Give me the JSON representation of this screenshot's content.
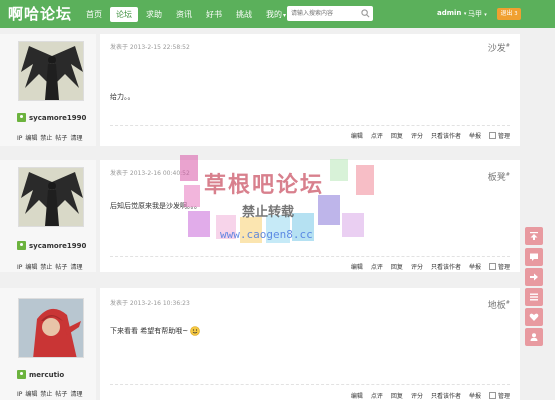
{
  "site": {
    "logo": "啊哈论坛"
  },
  "nav": {
    "items": [
      {
        "label": "首页"
      },
      {
        "label": "论坛"
      },
      {
        "label": "求助"
      },
      {
        "label": "资讯"
      },
      {
        "label": "好书"
      },
      {
        "label": "挑战"
      },
      {
        "label": "我的"
      }
    ],
    "active_index": 1
  },
  "search": {
    "placeholder": "请输入搜索内容"
  },
  "user": {
    "name": "admin",
    "level": "马甲",
    "logout": "退出"
  },
  "posts": [
    {
      "author": "sycamore1990",
      "admin_links": [
        "IP",
        "编辑",
        "禁止",
        "帖子",
        "清理"
      ],
      "time": "发表于 2013-2-15 22:58:52",
      "floor": "沙发",
      "text": "给力。。",
      "actions": [
        "编辑",
        "点评",
        "回复",
        "评分",
        "只看该作者",
        "举报",
        "管理"
      ]
    },
    {
      "author": "sycamore1990",
      "admin_links": [
        "IP",
        "编辑",
        "禁止",
        "帖子",
        "清理"
      ],
      "time": "发表于 2013-2-16 00:40:52",
      "floor": "板凳",
      "text": "后知后觉原来我是沙发啊。。。",
      "actions": [
        "编辑",
        "点评",
        "回复",
        "评分",
        "只看该作者",
        "举报",
        "管理"
      ]
    },
    {
      "author": "mercutio",
      "admin_links": [
        "IP",
        "编辑",
        "禁止",
        "帖子",
        "清理"
      ],
      "time": "发表于 2013-2-16 10:36:23",
      "floor": "地板",
      "text": "下来看看 希望有帮助哦~",
      "actions": [
        "编辑",
        "点评",
        "回复",
        "评分",
        "只看该作者",
        "举报",
        "管理"
      ]
    }
  ],
  "watermark": {
    "title": "草根吧论坛",
    "subtitle": "禁止转载",
    "url": "www.caogen8.cc"
  },
  "colors": {
    "topbar": "#5bb05b",
    "logout": "#f0a030",
    "tools": "#e89aa0"
  }
}
